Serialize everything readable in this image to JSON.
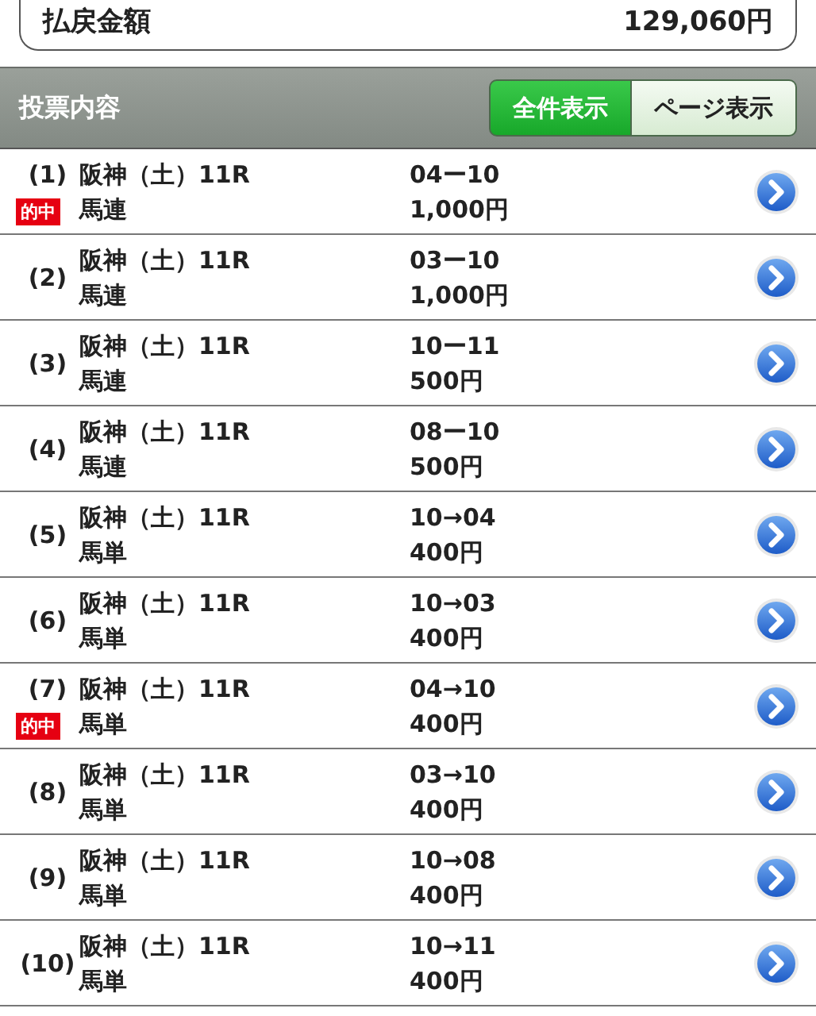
{
  "payout": {
    "label": "払戻金額",
    "amount": "129,060円"
  },
  "section": {
    "title": "投票内容",
    "buttons": [
      {
        "label": "全件表示",
        "selected": true
      },
      {
        "label": "ページ表示",
        "selected": false
      }
    ]
  },
  "bets": [
    {
      "number": "(1)",
      "race": "阪神（土）11R",
      "type": "馬連",
      "combination": "04ー10",
      "stake": "1,000円",
      "hit": true,
      "hit_label": "的中"
    },
    {
      "number": "(2)",
      "race": "阪神（土）11R",
      "type": "馬連",
      "combination": "03ー10",
      "stake": "1,000円",
      "hit": false
    },
    {
      "number": "(3)",
      "race": "阪神（土）11R",
      "type": "馬連",
      "combination": "10ー11",
      "stake": "500円",
      "hit": false
    },
    {
      "number": "(4)",
      "race": "阪神（土）11R",
      "type": "馬連",
      "combination": "08ー10",
      "stake": "500円",
      "hit": false
    },
    {
      "number": "(5)",
      "race": "阪神（土）11R",
      "type": "馬単",
      "combination": "10→04",
      "stake": "400円",
      "hit": false
    },
    {
      "number": "(6)",
      "race": "阪神（土）11R",
      "type": "馬単",
      "combination": "10→03",
      "stake": "400円",
      "hit": false
    },
    {
      "number": "(7)",
      "race": "阪神（土）11R",
      "type": "馬単",
      "combination": "04→10",
      "stake": "400円",
      "hit": true,
      "hit_label": "的中"
    },
    {
      "number": "(8)",
      "race": "阪神（土）11R",
      "type": "馬単",
      "combination": "03→10",
      "stake": "400円",
      "hit": false
    },
    {
      "number": "(9)",
      "race": "阪神（土）11R",
      "type": "馬単",
      "combination": "10→08",
      "stake": "400円",
      "hit": false
    },
    {
      "number": "(10)",
      "race": "阪神（土）11R",
      "type": "馬単",
      "combination": "10→11",
      "stake": "400円",
      "hit": false
    }
  ]
}
